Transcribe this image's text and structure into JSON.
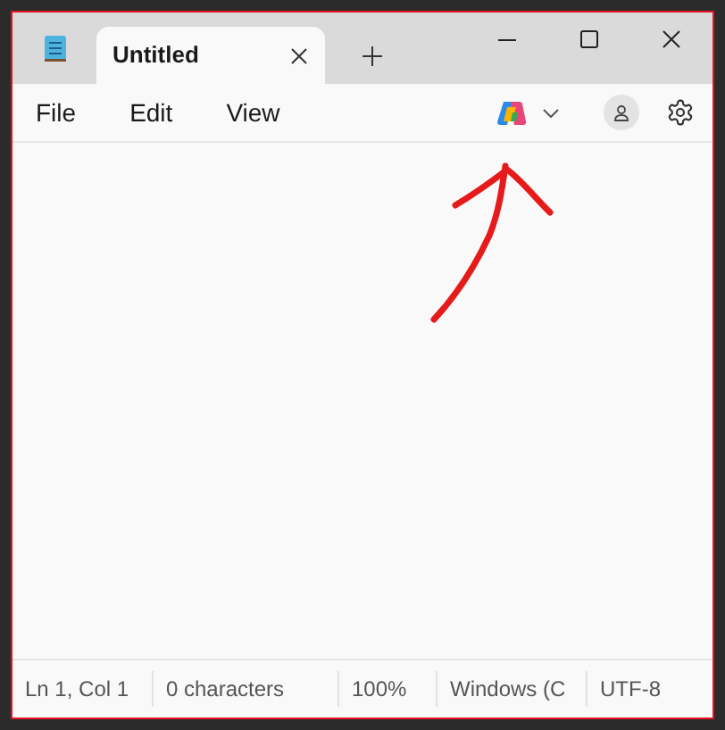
{
  "tab": {
    "title": "Untitled",
    "selected": true
  },
  "menu": [
    "File",
    "Edit",
    "View"
  ],
  "status_bar": [
    "Ln 1, Col 1",
    "0 characters",
    "100%",
    "Windows (C",
    "UTF-8"
  ]
}
